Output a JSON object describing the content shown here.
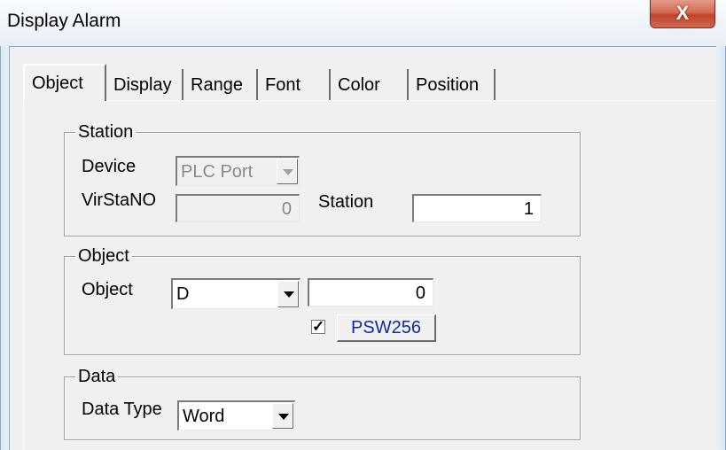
{
  "window": {
    "title": "Display Alarm",
    "close_label": "X"
  },
  "tabs": [
    "Object",
    "Display",
    "Range",
    "Font",
    "Color",
    "Position"
  ],
  "station_group": {
    "title": "Station",
    "device_label": "Device",
    "device_value": "PLC Port",
    "virstano_label": "VirStaNO",
    "virstano_value": "0",
    "station_label": "Station",
    "station_value": "1"
  },
  "object_group": {
    "title": "Object",
    "object_label": "Object",
    "object_type": "D",
    "object_address": "0",
    "check_mark": "✓",
    "psw_checked": true,
    "psw_button": "PSW256"
  },
  "data_group": {
    "title": "Data",
    "data_type_label": "Data Type",
    "data_type_value": "Word"
  }
}
